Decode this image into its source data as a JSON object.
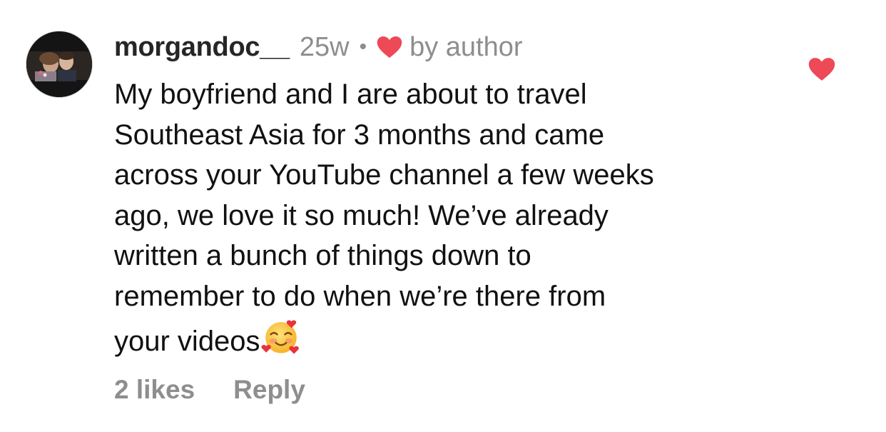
{
  "comment": {
    "username": "morgandoc__",
    "time": "25w",
    "separator": "•",
    "liked_by": "by author",
    "body": "My boyfriend and I are about to travel\nSoutheast Asia for 3 months and came\nacross your YouTube channel a few weeks\nago, we love it so much! We’ve already\nwritten a bunch of things down to\nremember to do when we’re there from\nyour videos",
    "emoji": "smiling-face-with-hearts",
    "likes": "2 likes",
    "reply_label": "Reply"
  },
  "icons": {
    "author_heart": "heart-icon",
    "like_button": "heart-icon"
  },
  "colors": {
    "heart": "#ed4956",
    "secondary_text": "#8e8e8e",
    "primary_text": "#111111"
  }
}
